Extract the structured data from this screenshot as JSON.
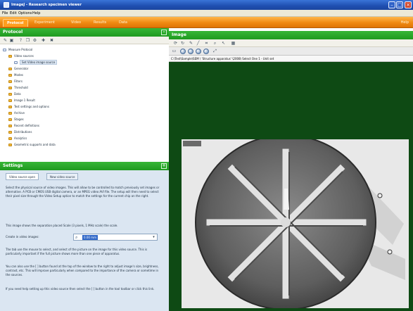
{
  "window": {
    "title": "ImageJ - Research specimen viewer"
  },
  "menubar": {
    "items": [
      "File",
      "Edit",
      "Options",
      "Help"
    ]
  },
  "tabs": [
    "Protocol",
    "Experiment",
    "Video",
    "Results",
    "Data"
  ],
  "help_link": "Help",
  "protocol": {
    "header": "Protocol",
    "tree": [
      {
        "label": "Measure Protocol",
        "indent": 0,
        "icon": "doc"
      },
      {
        "label": "Video sources",
        "indent": 1,
        "icon": "folder"
      },
      {
        "label": "Set Video image source",
        "indent": 2,
        "icon": "doc",
        "selected": true
      },
      {
        "label": "Generator",
        "indent": 1,
        "icon": "folder"
      },
      {
        "label": "Modes",
        "indent": 1,
        "icon": "folder"
      },
      {
        "label": "Filters",
        "indent": 1,
        "icon": "folder"
      },
      {
        "label": "Threshold",
        "indent": 1,
        "icon": "folder"
      },
      {
        "label": "Data",
        "indent": 1,
        "icon": "folder"
      },
      {
        "label": "Image 1 Result",
        "indent": 1,
        "icon": "folder"
      },
      {
        "label": "Test settings and options",
        "indent": 1,
        "icon": "folder"
      },
      {
        "label": "Archive",
        "indent": 1,
        "icon": "folder"
      },
      {
        "label": "Stages",
        "indent": 1,
        "icon": "folder"
      },
      {
        "label": "Recent definitions",
        "indent": 1,
        "icon": "folder"
      },
      {
        "label": "Distributions",
        "indent": 1,
        "icon": "folder"
      },
      {
        "label": "Analytics",
        "indent": 1,
        "icon": "folder"
      },
      {
        "label": "Geometric supports and data",
        "indent": 1,
        "icon": "folder"
      }
    ]
  },
  "settings": {
    "header": "Settings",
    "tabs": [
      "Video source open",
      "New video source"
    ],
    "paragraphs": [
      "Select the physical source of video images. This will allow to be controlled to match previously set images or alternative. A PCB or CMOS USB digital camera, or an MPEG video AVI file. The setup will then need to select their pixel size through the Video Setup option to match the settings for the current chip on the right.",
      "",
      "",
      "This image shows the separation placed Scale (3 pixels, 1 MHz scale) the scale."
    ],
    "scale_label": "Create in video images:",
    "scale_value": "0.00 mm",
    "more_paragraphs": [
      "The tab use the mouse to select, and select of the picture on the image for this video source. This is particularly important if the full picture shows more than one piece of apparatus.",
      "You can also use the [ ] button found at the top of the window to the right to adjust image's size, brightness, contrast, etc. This will improve particularly when compared to the importance of the camera or sometime in the sources.",
      "If you need help setting up this video source then select the [ ] button in the tool toolbar or click this link."
    ]
  },
  "image": {
    "header": "Image",
    "path": "C:\\Test\\Sample\\SEM \\ 'Structure apparatus' \\2008\\ Select One 1 - Unit set"
  },
  "colors": {
    "accent_green": "#22a022",
    "tab_orange": "#f08a12",
    "canvas_green": "#0e4a14"
  }
}
